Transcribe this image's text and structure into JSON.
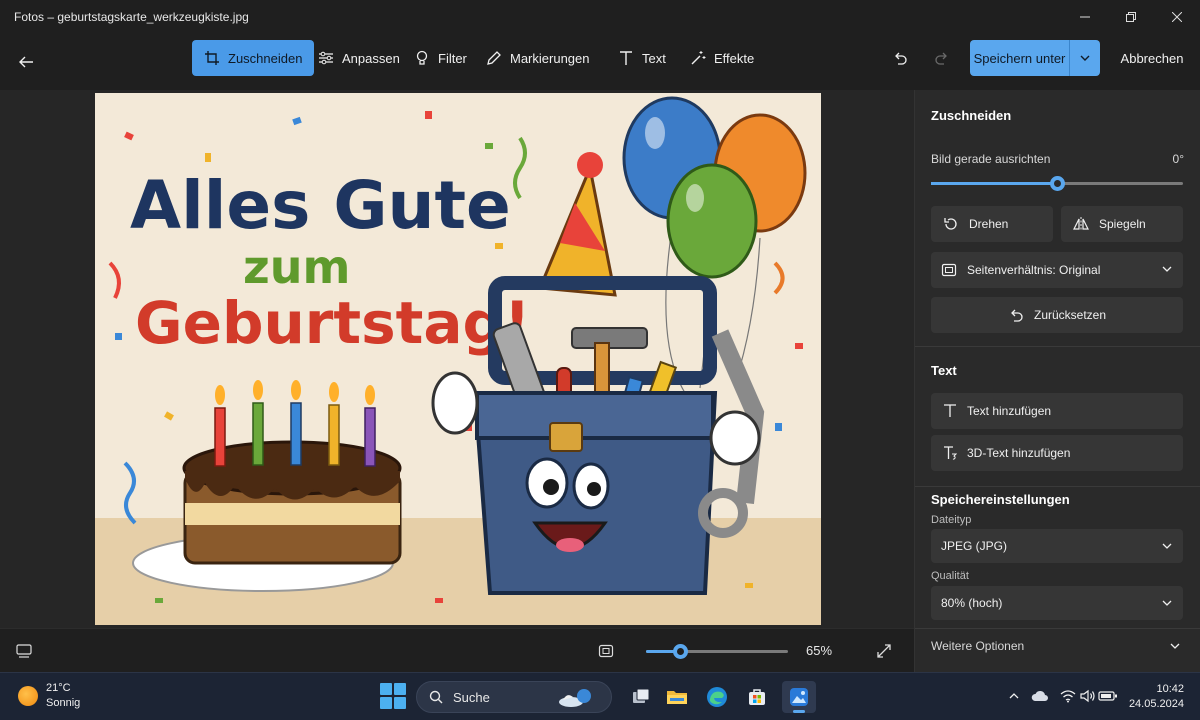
{
  "window": {
    "title": "Fotos – geburtstagskarte_werkzeugkiste.jpg"
  },
  "toolbar": {
    "tools": [
      {
        "label": "Zuschneiden",
        "icon": "crop-icon",
        "active": true
      },
      {
        "label": "Anpassen",
        "icon": "sliders-icon",
        "active": false
      },
      {
        "label": "Filter",
        "icon": "filter-icon",
        "active": false
      },
      {
        "label": "Markierungen",
        "icon": "pen-icon",
        "active": false
      },
      {
        "label": "Text",
        "icon": "text-icon",
        "active": false
      },
      {
        "label": "Effekte",
        "icon": "magic-wand-icon",
        "active": false
      }
    ],
    "save_label": "Speichern unter",
    "cancel_label": "Abbrechen"
  },
  "image": {
    "headline_1": "Alles Gute",
    "headline_2": "zum",
    "headline_3": "Geburtstag!"
  },
  "bottom": {
    "zoom_value": 0.24,
    "zoom_label": "65%"
  },
  "panel": {
    "crop": {
      "title": "Zuschneiden",
      "straighten_label": "Bild gerade ausrichten",
      "straighten_value_label": "0°",
      "straighten_position": 0.5,
      "rotate_label": "Drehen",
      "flip_label": "Spiegeln",
      "aspect_label": "Seitenverhältnis: Original",
      "reset_label": "Zurücksetzen"
    },
    "text": {
      "title": "Text",
      "add_text_label": "Text hinzufügen",
      "add_3d_text_label": "3D-Text hinzufügen"
    },
    "save_settings": {
      "title": "Speichereinstellungen",
      "filetype_label": "Dateityp",
      "filetype_value": "JPEG (JPG)",
      "quality_label": "Qualität",
      "quality_value": "80% (hoch)",
      "more_options_label": "Weitere Optionen"
    }
  },
  "taskbar": {
    "weather_temp": "21°C",
    "weather_desc": "Sonnig",
    "search_label": "Suche",
    "time": "10:42",
    "date": "24.05.2024"
  },
  "colors": {
    "accent": "#5aa7ee",
    "active_tool": "#4a9ae8",
    "panel_bg": "#2a2a2a",
    "taskbar_bg": "#1c2434"
  }
}
